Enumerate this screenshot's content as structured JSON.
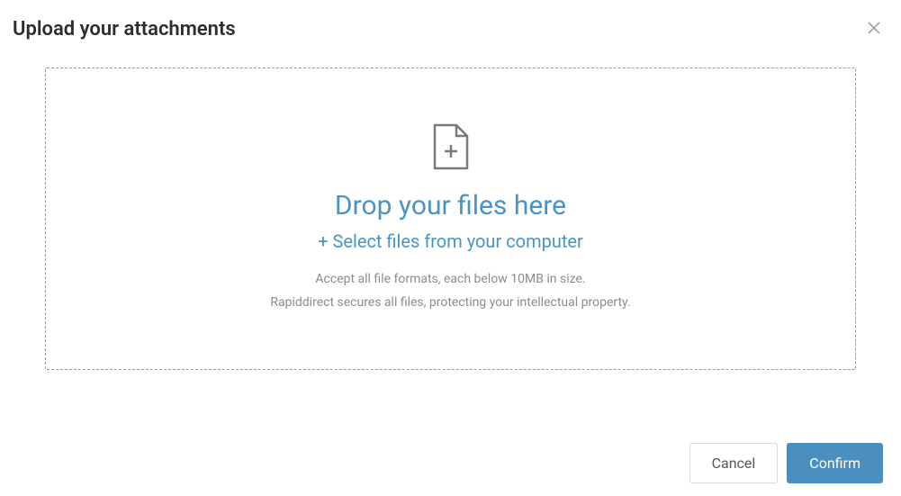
{
  "header": {
    "title": "Upload your attachments"
  },
  "dropzone": {
    "title": "Drop your files here",
    "select_label": "+ Select files from your computer",
    "hint1": "Accept all file formats, each below 10MB in size.",
    "hint2": "Rapiddirect secures all files, protecting your intellectual property."
  },
  "footer": {
    "cancel_label": "Cancel",
    "confirm_label": "Confirm"
  },
  "colors": {
    "accent": "#4a94c3",
    "button_primary": "#4a8fbf",
    "text_muted": "#8c8c8c",
    "border_dashed": "#999"
  }
}
